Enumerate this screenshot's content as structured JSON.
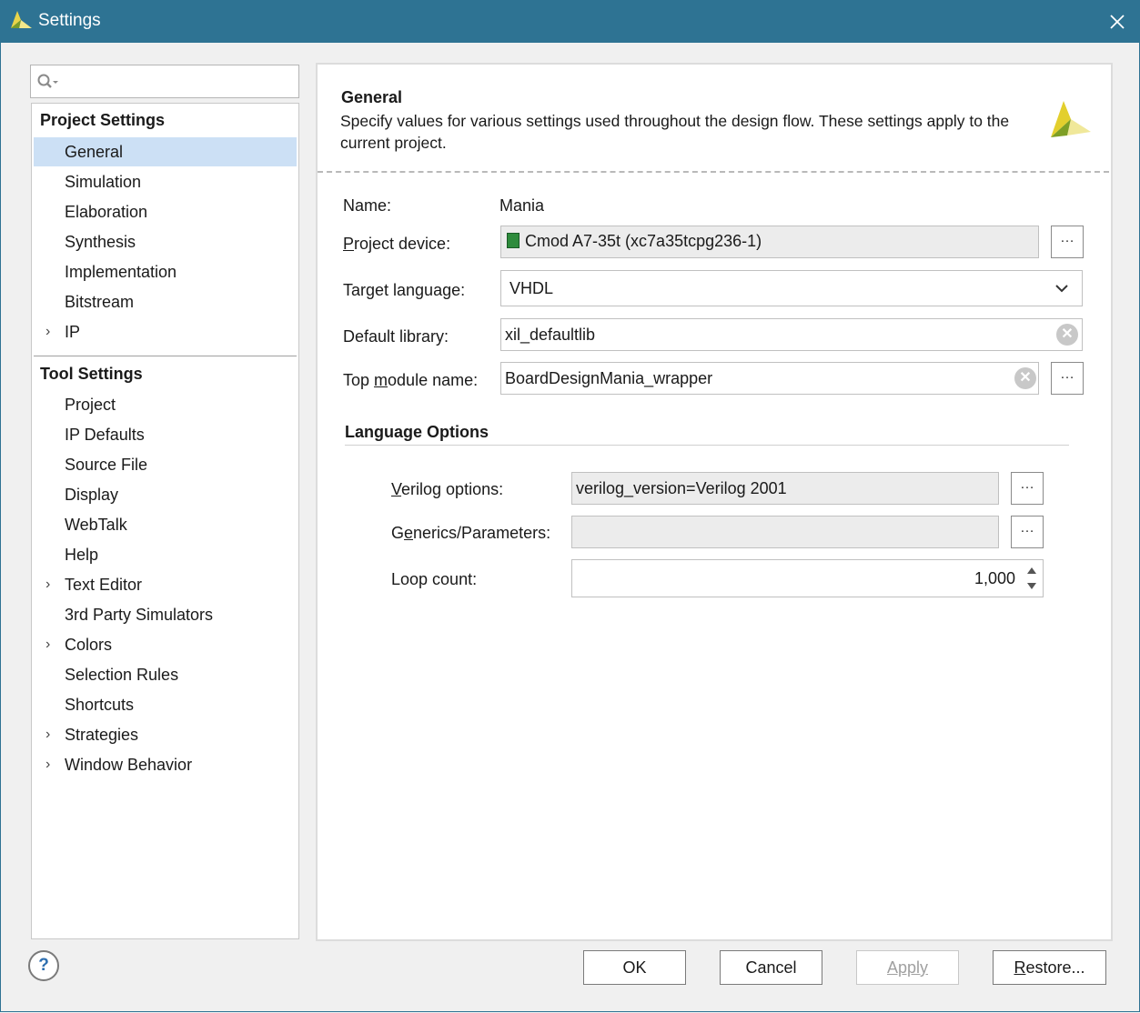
{
  "window": {
    "title": "Settings"
  },
  "search": {
    "placeholder": ""
  },
  "tree": {
    "project_settings": {
      "heading": "Project Settings",
      "items": [
        {
          "label": "General",
          "selected": true,
          "expandable": false
        },
        {
          "label": "Simulation",
          "expandable": false
        },
        {
          "label": "Elaboration",
          "expandable": false
        },
        {
          "label": "Synthesis",
          "expandable": false
        },
        {
          "label": "Implementation",
          "expandable": false
        },
        {
          "label": "Bitstream",
          "expandable": false
        },
        {
          "label": "IP",
          "expandable": true
        }
      ]
    },
    "tool_settings": {
      "heading": "Tool Settings",
      "items": [
        {
          "label": "Project",
          "expandable": false
        },
        {
          "label": "IP Defaults",
          "expandable": false
        },
        {
          "label": "Source File",
          "expandable": false
        },
        {
          "label": "Display",
          "expandable": false
        },
        {
          "label": "WebTalk",
          "expandable": false
        },
        {
          "label": "Help",
          "expandable": false
        },
        {
          "label": "Text Editor",
          "expandable": true
        },
        {
          "label": "3rd Party Simulators",
          "expandable": false
        },
        {
          "label": "Colors",
          "expandable": true
        },
        {
          "label": "Selection Rules",
          "expandable": false
        },
        {
          "label": "Shortcuts",
          "expandable": false
        },
        {
          "label": "Strategies",
          "expandable": true
        },
        {
          "label": "Window Behavior",
          "expandable": true
        }
      ]
    }
  },
  "general": {
    "title": "General",
    "description": "Specify values for various settings used throughout the design flow. These settings apply to the current project.",
    "name_label": "Name:",
    "name_value": "Mania",
    "device_label_u": "P",
    "device_label_rest": "roject device:",
    "device_value": "Cmod A7-35t (xc7a35tcpg236-1)",
    "language_label": "Target language:",
    "language_value": "VHDL",
    "library_label": "Default library:",
    "library_value": "xil_defaultlib",
    "top_label_a": "Top ",
    "top_label_u": "m",
    "top_label_b": "odule name:",
    "top_value": "BoardDesignMania_wrapper"
  },
  "language_options": {
    "title": "Language Options",
    "verilog_label_u": "V",
    "verilog_label_rest": "erilog options:",
    "verilog_value": "verilog_version=Verilog 2001",
    "generics_label_a": "G",
    "generics_label_u": "e",
    "generics_label_rest": "nerics/Parameters:",
    "generics_value": "",
    "loop_label": "Loop count:",
    "loop_value": "1,000"
  },
  "buttons": {
    "ok": "OK",
    "cancel": "Cancel",
    "apply": "Apply",
    "restore_u": "R",
    "restore_rest": "estore...",
    "ellipsis": "…",
    "help": "?"
  },
  "icons": {
    "app": "vivado-logo-icon",
    "close": "close-icon",
    "search": "search-icon",
    "device": "chip-icon",
    "dropdown": "chevron-down-icon",
    "clear": "clear-icon",
    "spinner": "spinner-arrows-icon"
  },
  "colors": {
    "titlebar": "#2e7393",
    "selection": "#cce0f5"
  }
}
